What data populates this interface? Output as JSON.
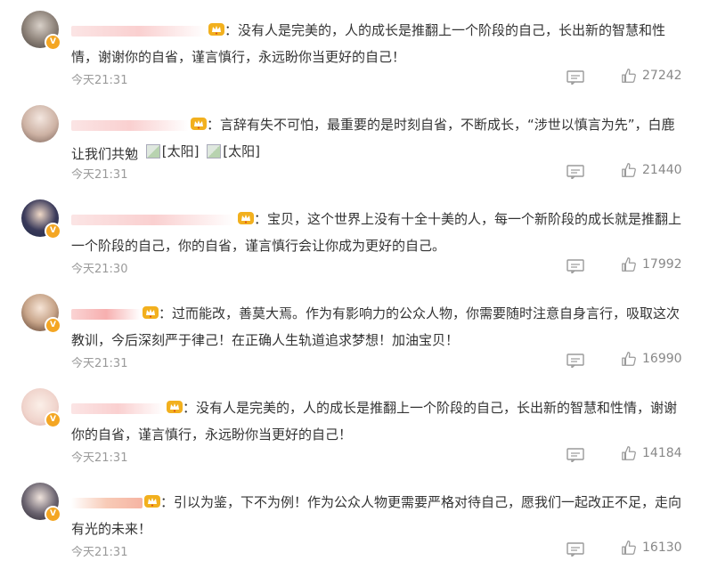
{
  "comments": [
    {
      "text": "：没有人是完美的，人的成长是推翻上一个阶段的自己，长出新的智慧和性情，谢谢你的自省，谨言慎行，永远盼你当更好的自己！",
      "time": "今天21:31",
      "likes": "27242"
    },
    {
      "text": "：言辞有失不可怕，最重要的是时刻自省，不断成长，“涉世以慎言为先”，白鹿让我们共勉",
      "emoji": [
        "[太阳]",
        "[太阳]"
      ],
      "time": "今天21:31",
      "likes": "21440"
    },
    {
      "text": "：宝贝，这个世界上没有十全十美的人，每一个新阶段的成长就是推翻上一个阶段的自己，你的自省，谨言慎行会让你成为更好的自己。",
      "time": "今天21:30",
      "likes": "17992"
    },
    {
      "text": "：过而能改，善莫大焉。作为有影响力的公众人物，你需要随时注意自身言行，吸取这次教训，今后深刻严于律己！在正确人生轨道追求梦想！加油宝贝！",
      "time": "今天21:31",
      "likes": "16990"
    },
    {
      "text": "：没有人是完美的，人的成长是推翻上一个阶段的自己，长出新的智慧和性情，谢谢你的自省，谨言慎行，永远盼你当更好的自己！",
      "time": "今天21:31",
      "likes": "14184"
    },
    {
      "text": "：引以为鉴，下不为例！作为公众人物更需要严格对待自己，愿我们一起改正不足，走向有光的未来！",
      "time": "今天21:31",
      "likes": "16130"
    }
  ],
  "colors": {
    "text": "#333333",
    "meta": "#9a9a9a",
    "icon": "#9a9a9a",
    "badge": "#f4a623",
    "crown": "#f2b01e"
  }
}
